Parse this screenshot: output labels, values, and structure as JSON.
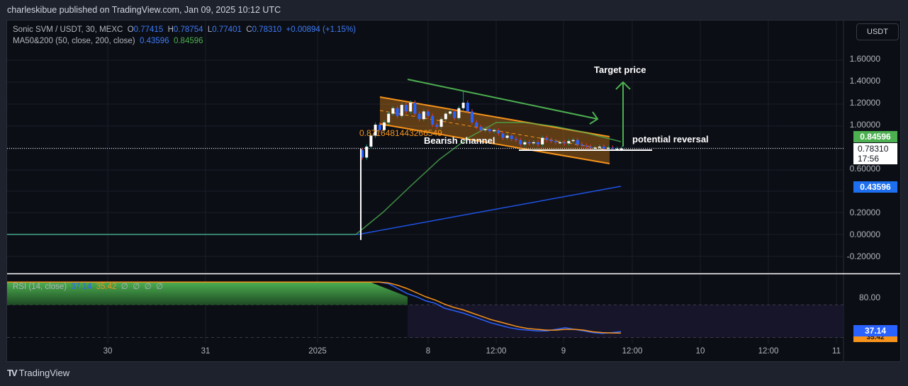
{
  "publisher_line": "charleskibue published on TradingView.com, Jan 09, 2025 10:12 UTC",
  "legend": {
    "symbol": "Sonic SVM / USDT, 30, MEXC",
    "o_label": "O",
    "o": "0.77415",
    "h_label": "H",
    "h": "0.78754",
    "l_label": "L",
    "l": "0.77401",
    "c_label": "C",
    "c": "0.78310",
    "change": "+0.00894 (+1.15%)",
    "ma_name": "MA50&200 (50, close, 200, close)",
    "ma200": "0.43596",
    "ma50": "0.84596"
  },
  "currency_button": "USDT",
  "price_tags": {
    "ma50": "0.84596",
    "last": "0.78310",
    "countdown": "17:56",
    "ma200": "0.43596"
  },
  "rsi": {
    "name": "RSI (14, close)",
    "value": "37.14",
    "ma": "35.42",
    "extra": [
      "∅",
      "∅",
      "∅",
      "∅"
    ],
    "tick": "80.00",
    "tag": "37.14",
    "tag2": "35.42"
  },
  "annotations": {
    "target": "Target price",
    "channel": "Bearish channel",
    "reversal": "potential reversal",
    "fib_label": "0.8716481443266549"
  },
  "footer_logo": "TradingView",
  "colors": {
    "up": "#ffffff",
    "down": "#2962ff",
    "wick_up": "#089981",
    "wick_down": "#f23645",
    "ma50": "#4caf50",
    "ma200": "#1e53e5",
    "channel": "#f7931a"
  },
  "chart_data": {
    "type": "candlestick",
    "title": "Sonic SVM / USDT, 30, MEXC",
    "ylim": [
      -0.3,
      1.75
    ],
    "y_ticks": [
      "1.60000",
      "1.40000",
      "1.20000",
      "1.00000",
      "0.60000",
      "0.20000",
      "0.00000",
      "-0.20000"
    ],
    "y_tick_values": [
      1.6,
      1.4,
      1.2,
      1.0,
      0.6,
      0.2,
      0.0,
      -0.2
    ],
    "x_ticks": [
      "30",
      "31",
      "2025",
      "8",
      "12:00",
      "9",
      "12:00",
      "10",
      "12:00",
      "11"
    ],
    "closes": [
      0.7,
      0.8,
      0.9,
      1.0,
      0.95,
      1.02,
      1.1,
      1.15,
      1.08,
      1.18,
      1.12,
      1.2,
      1.1,
      1.05,
      1.12,
      1.08,
      1.0,
      0.98,
      1.05,
      1.1,
      1.12,
      1.06,
      1.15,
      1.2,
      1.12,
      1.02,
      0.98,
      0.95,
      0.96,
      0.94,
      0.95,
      0.92,
      0.88,
      0.9,
      0.87,
      0.86,
      0.82,
      0.84,
      0.83,
      0.84,
      0.82,
      0.88,
      0.86,
      0.85,
      0.84,
      0.84,
      0.83,
      0.85,
      0.86,
      0.82,
      0.81,
      0.8,
      0.79,
      0.79,
      0.8,
      0.78,
      0.79,
      0.78,
      0.78,
      0.783
    ],
    "ma50_last": 0.84596,
    "ma200_last": 0.43596,
    "rsi_series": [
      98,
      98,
      96,
      90,
      84,
      80,
      75,
      72,
      66,
      63,
      60,
      56,
      52,
      48,
      45,
      42,
      40,
      39,
      38,
      38,
      40,
      42,
      40,
      38,
      36,
      35,
      36,
      37.14
    ],
    "rsi_ma_series": [
      98,
      98,
      97,
      94,
      90,
      85,
      80,
      76,
      71,
      67,
      64,
      60,
      56,
      52,
      49,
      46,
      43,
      41,
      40,
      39,
      39,
      40,
      40,
      39,
      37,
      36,
      35.5,
      35.42
    ]
  }
}
